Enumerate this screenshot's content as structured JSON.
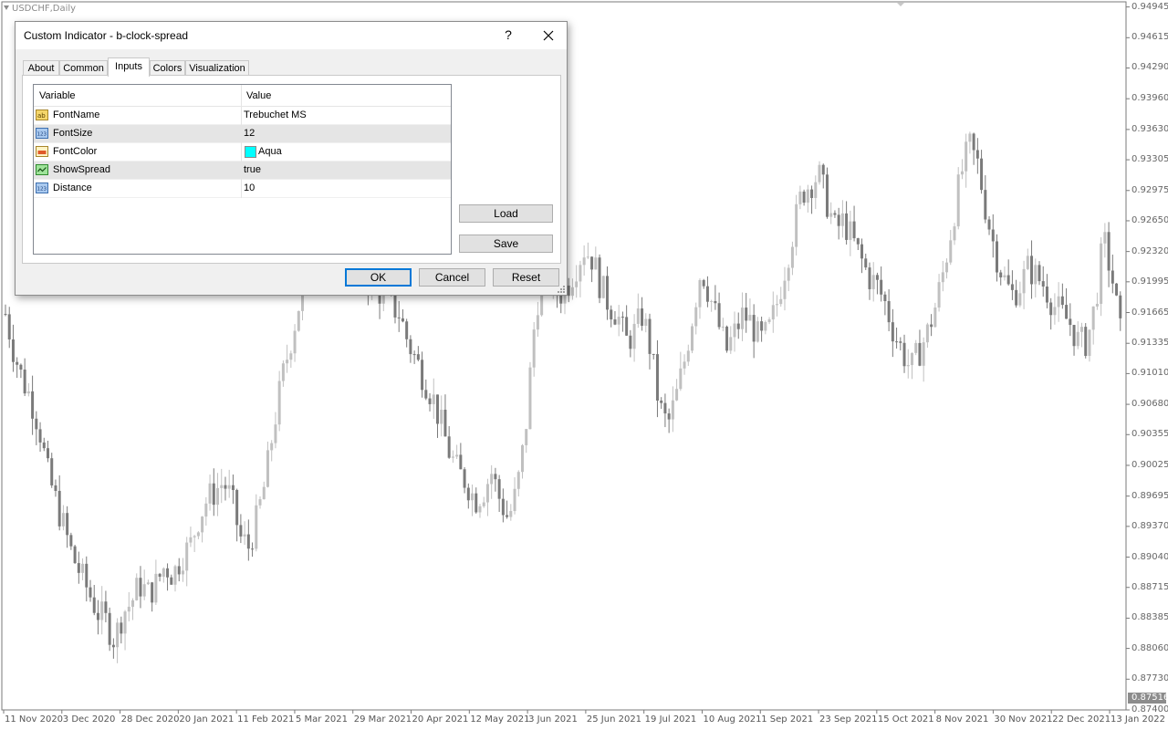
{
  "chart": {
    "title": "USDCHF,Daily",
    "price_labels": [
      "0.94945",
      "0.94615",
      "0.94290",
      "0.93960",
      "0.93630",
      "0.93305",
      "0.92975",
      "0.92650",
      "0.92320",
      "0.91995",
      "0.91665",
      "0.91335",
      "0.91010",
      "0.90680",
      "0.90355",
      "0.90025",
      "0.89695",
      "0.89370",
      "0.89040",
      "0.88715",
      "0.88385",
      "0.88060",
      "0.87730",
      "0.87400"
    ],
    "current_price": "0.87516",
    "date_labels": [
      "11 Nov 2020",
      "3 Dec 2020",
      "28 Dec 2020",
      "20 Jan 2021",
      "11 Feb 2021",
      "5 Mar 2021",
      "29 Mar 2021",
      "20 Apr 2021",
      "12 May 2021",
      "3 Jun 2021",
      "25 Jun 2021",
      "19 Jul 2021",
      "10 Aug 2021",
      "1 Sep 2021",
      "23 Sep 2021",
      "15 Oct 2021",
      "8 Nov 2021",
      "30 Nov 2021",
      "22 Dec 2021",
      "13 Jan 2022"
    ],
    "colors": {
      "bull": "#c0c0c0",
      "bear": "#7a7a7a",
      "axis": "#7a7a7a"
    }
  },
  "chart_data": {
    "type": "candlestick",
    "title": "USDCHF,Daily",
    "ylim": [
      0.874,
      0.95
    ],
    "x_tick_labels": [
      "11 Nov 2020",
      "3 Dec 2020",
      "28 Dec 2020",
      "20 Jan 2021",
      "11 Feb 2021",
      "5 Mar 2021",
      "29 Mar 2021",
      "20 Apr 2021",
      "12 May 2021",
      "3 Jun 2021",
      "25 Jun 2021",
      "19 Jul 2021",
      "10 Aug 2021",
      "1 Sep 2021",
      "23 Sep 2021",
      "15 Oct 2021",
      "8 Nov 2021",
      "30 Nov 2021",
      "22 Dec 2021",
      "13 Jan 2022"
    ],
    "close_path": [
      0.9165,
      0.9125,
      0.9095,
      0.9075,
      0.9045,
      0.8995,
      0.8965,
      0.8935,
      0.8905,
      0.8885,
      0.8865,
      0.8845,
      0.8835,
      0.8815,
      0.8845,
      0.8855,
      0.8875,
      0.8865,
      0.8875,
      0.8895,
      0.8885,
      0.8905,
      0.8915,
      0.8945,
      0.8965,
      0.8975,
      0.8985,
      0.8965,
      0.8925,
      0.8915,
      0.8945,
      0.8985,
      0.9045,
      0.9095,
      0.9135,
      0.9175,
      0.9215,
      0.9255,
      0.9275,
      0.9265,
      0.9245,
      0.9225,
      0.9215,
      0.9205,
      0.9195,
      0.9185,
      0.9175,
      0.9165,
      0.9135,
      0.9115,
      0.9095,
      0.9075,
      0.9045,
      0.9015,
      0.8995,
      0.8985,
      0.8965,
      0.8975,
      0.8995,
      0.8965,
      0.8945,
      0.8975,
      0.9035,
      0.9145,
      0.9215,
      0.9205,
      0.9185,
      0.9195,
      0.9215,
      0.9235,
      0.9225,
      0.9195,
      0.9175,
      0.9165,
      0.9135,
      0.9145,
      0.9165,
      0.9125,
      0.9065,
      0.9045,
      0.9075,
      0.9115,
      0.9165,
      0.9215,
      0.9185,
      0.9155,
      0.9125,
      0.9145,
      0.9165,
      0.9155,
      0.9135,
      0.9145,
      0.9175,
      0.9215,
      0.9255,
      0.9295,
      0.9305,
      0.9315,
      0.9285,
      0.9255,
      0.9265,
      0.9245,
      0.9225,
      0.9205,
      0.9195,
      0.9175,
      0.9145,
      0.9125,
      0.9105,
      0.9125,
      0.9145,
      0.9175,
      0.9215,
      0.9265,
      0.9315,
      0.9345,
      0.9325,
      0.9275,
      0.9235,
      0.9205,
      0.9185,
      0.9195,
      0.9215,
      0.9205,
      0.9195,
      0.9175,
      0.9165,
      0.9155,
      0.9135,
      0.9135,
      0.9175,
      0.9245,
      0.9205,
      0.9145
    ]
  },
  "dialog": {
    "title": "Custom Indicator - b-clock-spread",
    "help": "?",
    "tabs": [
      "About",
      "Common",
      "Inputs",
      "Colors",
      "Visualization"
    ],
    "active_tab": "Inputs",
    "grid": {
      "col_variable": "Variable",
      "col_value": "Value",
      "rows": [
        {
          "icon": "string-icon",
          "name": "FontName",
          "value": "Trebuchet MS"
        },
        {
          "icon": "integer-icon",
          "name": "FontSize",
          "value": "12"
        },
        {
          "icon": "color-icon",
          "name": "FontColor",
          "value": "Aqua",
          "swatch": "#00ffff"
        },
        {
          "icon": "boolean-icon",
          "name": "ShowSpread",
          "value": "true"
        },
        {
          "icon": "integer-icon",
          "name": "Distance",
          "value": "10"
        }
      ]
    },
    "buttons": {
      "load": "Load",
      "save": "Save",
      "ok": "OK",
      "cancel": "Cancel",
      "reset": "Reset"
    }
  }
}
